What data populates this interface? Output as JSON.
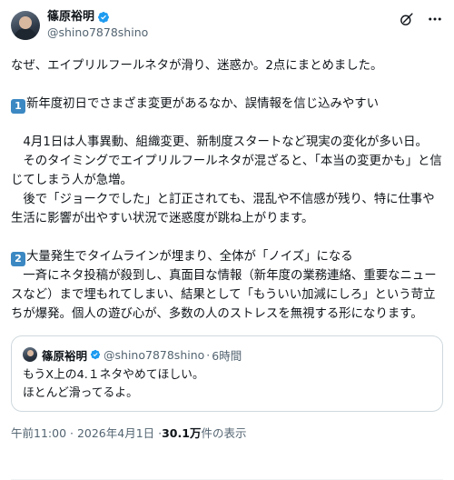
{
  "author": {
    "name": "篠原裕明",
    "handle": "@shino7878shino"
  },
  "icons": {
    "verified": "verified-badge-icon",
    "grok": "grok-icon",
    "more": "more-options-icon"
  },
  "colors": {
    "verified": "#1d9bf0",
    "badge": "#3b88c3",
    "secondary_text": "#536471"
  },
  "post": {
    "intro": "なぜ、エイプリルフールネタが滑り、迷惑か。2点にまとめました。",
    "point1_badge": "1",
    "point1_heading": "新年度初日でさまざま変更があるなか、誤情報を信じ込みやすい",
    "point1_body": "　4月1日は人事異動、組織変更、新制度スタートなど現実の変化が多い日。\n　そのタイミングでエイプリルフールネタが混ざると、「本当の変更かも」と信じてしまう人が急増。\n　後で「ジョークでした」と訂正されても、混乱や不信感が残り、特に仕事や生活に影響が出やすい状況で迷惑度が跳ね上がります。",
    "point2_badge": "2",
    "point2_heading": "大量発生でタイムラインが埋まり、全体が「ノイズ」になる",
    "point2_body": "　一斉にネタ投稿が殺到し、真面目な情報（新年度の業務連絡、重要なニュースなど）まで埋もれてしまい、結果として「もういい加減にしろ」という苛立ちが爆発。個人の遊び心が、多数の人のストレスを無視する形になります。"
  },
  "quote": {
    "name": "篠原裕明",
    "handle": "@shino7878shino",
    "separator": "·",
    "time": "6時間",
    "text": "もうX上の4.１ネタやめてほしい。\nほとんど滑ってるよ。"
  },
  "meta": {
    "timestamp": "午前11:00 · 2026年4月1日 · ",
    "views_count": "30.1万",
    "views_label": " 件の表示"
  }
}
